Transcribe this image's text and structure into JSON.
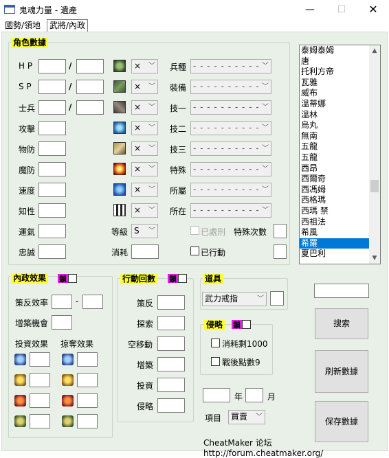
{
  "window": {
    "title": "鬼魂力量 - 遺產",
    "min": "—",
    "max": "☐",
    "close": "✕"
  },
  "tabs": [
    "國勢/領地",
    "武將/內政"
  ],
  "character": {
    "legend": "角色數據",
    "hp": "H P",
    "sp": "S P",
    "soldiers": "士兵",
    "slash": "/",
    "attack": "攻擊",
    "phys_def": "物防",
    "magic_def": "魔防",
    "speed": "速度",
    "intellect": "知性",
    "luck": "運氣",
    "loyalty": "忠誠",
    "icon_x": "×",
    "level_label": "等級",
    "level_value": "S",
    "consume_label": "消耗",
    "right_labels": [
      "兵種",
      "裝備",
      "技一",
      "技二",
      "技三",
      "特殊",
      "所屬",
      "所在"
    ],
    "dash": "- - - - - - - - - -",
    "dealt_label": "已處刑",
    "special_count_label": "特殊次數",
    "acted_label": "已行動"
  },
  "list": {
    "items": [
      "泰姆泰姆",
      "唐",
      "托利方帝",
      "瓦雅",
      "威布",
      "溫蒂娜",
      "溫林",
      "烏丸",
      "無南",
      "五龍",
      "五龍",
      "西昂",
      "西爾奇",
      "西馮姆",
      "西格瑪",
      "西瑪 禁",
      "西祖法",
      "希風",
      "希羅",
      "夏巴利"
    ],
    "selected_index": 18,
    "scroll_up": "▲",
    "scroll_down": "▼"
  },
  "internal": {
    "legend": "內政效果",
    "lock": "鎖",
    "policy_rate": "策反效率",
    "dash": "-",
    "build_chance": "增築機會",
    "invest_effect": "投資效果",
    "plunder_effect": "掠奪效果"
  },
  "action": {
    "legend": "行動回數",
    "lock": "鎖",
    "labels": [
      "策反",
      "探索",
      "空移動",
      "增築",
      "投資",
      "侵略"
    ]
  },
  "items_group": {
    "legend": "道具",
    "value": "武力戒指"
  },
  "invasion": {
    "legend": "侵略",
    "lock": "鎖",
    "opt1": "消耗剩1000",
    "opt2": "戰後點數9"
  },
  "date": {
    "year": "年",
    "month": "月"
  },
  "project": {
    "label": "項目",
    "value": "買賣"
  },
  "buttons": {
    "search": "搜索",
    "refresh": "刷新數據",
    "save": "保存數據"
  },
  "footer": "CheatMaker 论坛 http://forum.cheatmaker.org/"
}
